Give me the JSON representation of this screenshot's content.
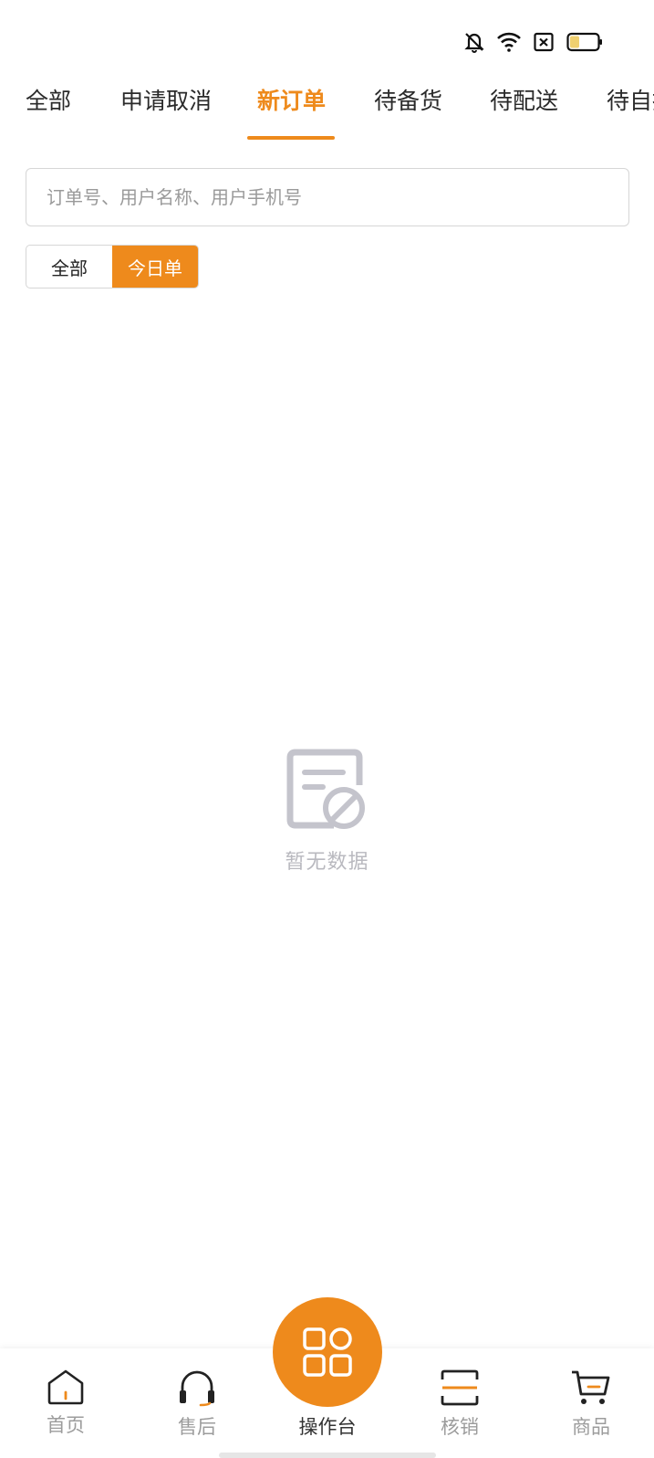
{
  "status_bar": {
    "icons": [
      "mute-bell-icon",
      "wifi-icon",
      "sim-x-icon",
      "battery-icon"
    ]
  },
  "tabs": [
    {
      "label": "全部"
    },
    {
      "label": "申请取消"
    },
    {
      "label": "新订单",
      "active": true
    },
    {
      "label": "待备货"
    },
    {
      "label": "待配送"
    },
    {
      "label": "待自提"
    }
  ],
  "search": {
    "placeholder": "订单号、用户名称、用户手机号",
    "value": ""
  },
  "filter": {
    "options": [
      "全部",
      "今日单"
    ],
    "selected": "今日单"
  },
  "empty_state": {
    "icon": "no-data-document-icon",
    "text": "暂无数据"
  },
  "bottom_nav": {
    "items": [
      {
        "label": "首页",
        "icon": "home-icon"
      },
      {
        "label": "售后",
        "icon": "headset-icon"
      },
      {
        "label": "操作台",
        "icon": "grid-icon",
        "center": true
      },
      {
        "label": "核销",
        "icon": "scan-icon"
      },
      {
        "label": "商品",
        "icon": "cart-icon"
      }
    ]
  },
  "colors": {
    "accent": "#ee8a1c",
    "muted": "#9c9c9c"
  }
}
